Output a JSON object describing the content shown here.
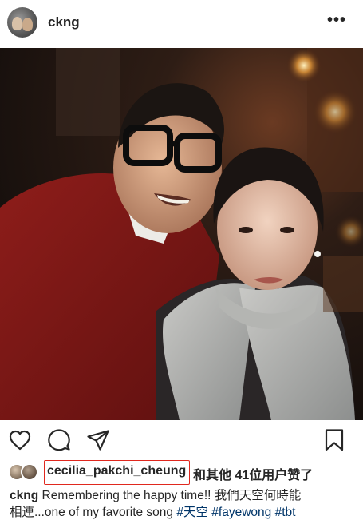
{
  "header": {
    "username": "ckng",
    "more_label": "•••"
  },
  "actions": {
    "like": "heart-icon",
    "comment": "comment-icon",
    "share": "share-icon",
    "save": "bookmark-icon"
  },
  "likes": {
    "liker_username": "cecilia_pakchi_cheung",
    "rest_text": "和其他 41位用户赞了"
  },
  "caption": {
    "username": "ckng",
    "text_line1": "Remembering the happy time!! 我們天空何時能",
    "text_line2": "相連...one of my favorite song ",
    "hashtags": [
      "#天空",
      "#fayewong",
      "#tbt"
    ]
  },
  "colors": {
    "highlight_box": "#e0281e",
    "hashtag": "#003569",
    "text": "#262626"
  }
}
